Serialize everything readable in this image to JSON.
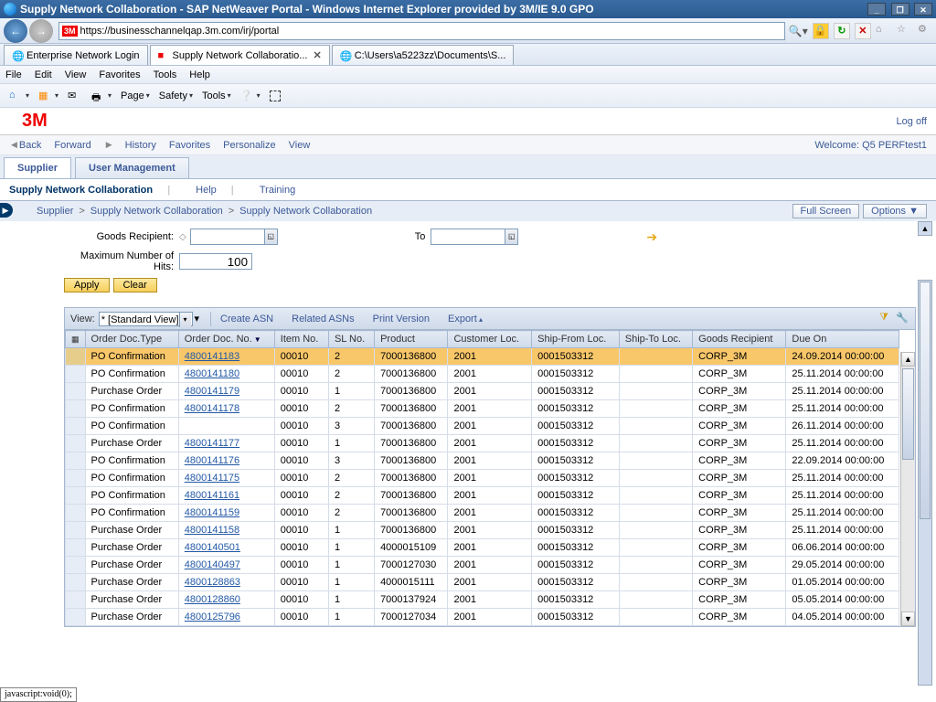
{
  "window": {
    "title": "Supply Network Collaboration - SAP NetWeaver Portal - Windows Internet Explorer provided by 3M/IE 9.0 GPO",
    "url": "https://businesschannelqap.3m.com/irj/portal"
  },
  "ietabs": [
    {
      "label": "Enterprise Network Login",
      "active": false
    },
    {
      "label": "Supply Network Collaboratio...",
      "active": true
    },
    {
      "label": "C:\\Users\\a5223zz\\Documents\\S...",
      "active": false
    }
  ],
  "iemenu": [
    "File",
    "Edit",
    "View",
    "Favorites",
    "Tools",
    "Help"
  ],
  "cmdbar": {
    "page": "Page",
    "safety": "Safety",
    "tools": "Tools"
  },
  "portal": {
    "logoff": "Log off",
    "nav": {
      "back": "Back",
      "forward": "Forward",
      "history": "History",
      "favorites": "Favorites",
      "personalize": "Personalize",
      "view": "View"
    },
    "welcome": "Welcome: Q5 PERFtest1",
    "tabs": {
      "supplier": "Supplier",
      "usermgmt": "User Management"
    },
    "submenu": {
      "title": "Supply Network Collaboration",
      "help": "Help",
      "training": "Training"
    },
    "breadcrumb": [
      "Supplier",
      "Supply Network Collaboration",
      "Supply Network Collaboration"
    ],
    "fullscreen": "Full Screen",
    "options": "Options ▼"
  },
  "selection": {
    "goodsRecipientLabel": "Goods Recipient:",
    "toLabel": "To",
    "maxHitsLabel": "Maximum Number of Hits:",
    "maxHitsValue": "100",
    "apply": "Apply",
    "clear": "Clear"
  },
  "tableTool": {
    "viewLabel": "View:",
    "viewValue": "* [Standard View]",
    "createAsn": "Create ASN",
    "relatedAsns": "Related ASNs",
    "printVersion": "Print Version",
    "export": "Export"
  },
  "columns": [
    "Order Doc.Type",
    "Order Doc. No.",
    "Item No.",
    "SL No.",
    "Product",
    "Customer Loc.",
    "Ship-From Loc.",
    "Ship-To Loc.",
    "Goods Recipient",
    "Due On"
  ],
  "rows": [
    {
      "hl": true,
      "type": "PO Confirmation",
      "doc": "4800141183",
      "item": "00010",
      "sl": "2",
      "prod": "7000136800",
      "cust": "2001",
      "from": "0001503312",
      "to": "",
      "gr": "CORP_3M",
      "due": "24.09.2014 00:00:00"
    },
    {
      "hl": false,
      "type": "PO Confirmation",
      "doc": "4800141180",
      "item": "00010",
      "sl": "2",
      "prod": "7000136800",
      "cust": "2001",
      "from": "0001503312",
      "to": "",
      "gr": "CORP_3M",
      "due": "25.11.2014 00:00:00"
    },
    {
      "hl": false,
      "type": "Purchase Order",
      "doc": "4800141179",
      "item": "00010",
      "sl": "1",
      "prod": "7000136800",
      "cust": "2001",
      "from": "0001503312",
      "to": "",
      "gr": "CORP_3M",
      "due": "25.11.2014 00:00:00"
    },
    {
      "hl": false,
      "type": "PO Confirmation",
      "doc": "4800141178",
      "item": "00010",
      "sl": "2",
      "prod": "7000136800",
      "cust": "2001",
      "from": "0001503312",
      "to": "",
      "gr": "CORP_3M",
      "due": "25.11.2014 00:00:00"
    },
    {
      "hl": false,
      "type": "PO Confirmation",
      "doc": "",
      "item": "00010",
      "sl": "3",
      "prod": "7000136800",
      "cust": "2001",
      "from": "0001503312",
      "to": "",
      "gr": "CORP_3M",
      "due": "26.11.2014 00:00:00"
    },
    {
      "hl": false,
      "type": "Purchase Order",
      "doc": "4800141177",
      "item": "00010",
      "sl": "1",
      "prod": "7000136800",
      "cust": "2001",
      "from": "0001503312",
      "to": "",
      "gr": "CORP_3M",
      "due": "25.11.2014 00:00:00"
    },
    {
      "hl": false,
      "type": "PO Confirmation",
      "doc": "4800141176",
      "item": "00010",
      "sl": "3",
      "prod": "7000136800",
      "cust": "2001",
      "from": "0001503312",
      "to": "",
      "gr": "CORP_3M",
      "due": "22.09.2014 00:00:00"
    },
    {
      "hl": false,
      "type": "PO Confirmation",
      "doc": "4800141175",
      "item": "00010",
      "sl": "2",
      "prod": "7000136800",
      "cust": "2001",
      "from": "0001503312",
      "to": "",
      "gr": "CORP_3M",
      "due": "25.11.2014 00:00:00"
    },
    {
      "hl": false,
      "type": "PO Confirmation",
      "doc": "4800141161",
      "item": "00010",
      "sl": "2",
      "prod": "7000136800",
      "cust": "2001",
      "from": "0001503312",
      "to": "",
      "gr": "CORP_3M",
      "due": "25.11.2014 00:00:00"
    },
    {
      "hl": false,
      "type": "PO Confirmation",
      "doc": "4800141159",
      "item": "00010",
      "sl": "2",
      "prod": "7000136800",
      "cust": "2001",
      "from": "0001503312",
      "to": "",
      "gr": "CORP_3M",
      "due": "25.11.2014 00:00:00"
    },
    {
      "hl": false,
      "type": "Purchase Order",
      "doc": "4800141158",
      "item": "00010",
      "sl": "1",
      "prod": "7000136800",
      "cust": "2001",
      "from": "0001503312",
      "to": "",
      "gr": "CORP_3M",
      "due": "25.11.2014 00:00:00"
    },
    {
      "hl": false,
      "type": "Purchase Order",
      "doc": "4800140501",
      "item": "00010",
      "sl": "1",
      "prod": "4000015109",
      "cust": "2001",
      "from": "0001503312",
      "to": "",
      "gr": "CORP_3M",
      "due": "06.06.2014 00:00:00"
    },
    {
      "hl": false,
      "type": "Purchase Order",
      "doc": "4800140497",
      "item": "00010",
      "sl": "1",
      "prod": "7000127030",
      "cust": "2001",
      "from": "0001503312",
      "to": "",
      "gr": "CORP_3M",
      "due": "29.05.2014 00:00:00"
    },
    {
      "hl": false,
      "type": "Purchase Order",
      "doc": "4800128863",
      "item": "00010",
      "sl": "1",
      "prod": "4000015111",
      "cust": "2001",
      "from": "0001503312",
      "to": "",
      "gr": "CORP_3M",
      "due": "01.05.2014 00:00:00"
    },
    {
      "hl": false,
      "type": "Purchase Order",
      "doc": "4800128860",
      "item": "00010",
      "sl": "1",
      "prod": "7000137924",
      "cust": "2001",
      "from": "0001503312",
      "to": "",
      "gr": "CORP_3M",
      "due": "05.05.2014 00:00:00"
    },
    {
      "hl": false,
      "type": "Purchase Order",
      "doc": "4800125796",
      "item": "00010",
      "sl": "1",
      "prod": "7000127034",
      "cust": "2001",
      "from": "0001503312",
      "to": "",
      "gr": "CORP_3M",
      "due": "04.05.2014 00:00:00"
    }
  ],
  "status": "javascript:void(0);"
}
